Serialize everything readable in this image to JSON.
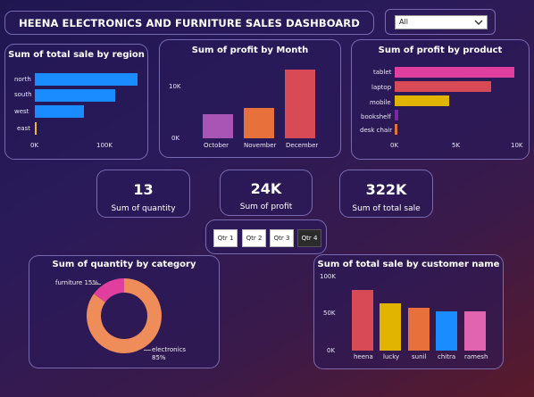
{
  "header": {
    "title": "HEENA ELECTRONICS AND FURNITURE SALES DASHBOARD"
  },
  "filter": {
    "selected": "All"
  },
  "region_chart": {
    "title": "Sum of total sale by region",
    "categories": [
      "north",
      "south",
      "west",
      "east"
    ],
    "ticks": [
      "0K",
      "100K"
    ],
    "color": "#1a8cff",
    "accent": "#f2b632"
  },
  "month_chart": {
    "title": "Sum of profit by Month",
    "categories": [
      "October",
      "November",
      "December"
    ],
    "ticks": [
      "10K",
      "0K"
    ],
    "colors": [
      "#a855b5",
      "#e8703a",
      "#d84a55"
    ]
  },
  "product_chart": {
    "title": "Sum of profit by product",
    "categories": [
      "tablet",
      "laptop",
      "mobile",
      "bookshelf",
      "desk chair"
    ],
    "ticks": [
      "0K",
      "5K",
      "10K"
    ],
    "colors": [
      "#e03fa0",
      "#d84a55",
      "#e0b400",
      "#7a2aa0",
      "#e8703a"
    ]
  },
  "kpis": {
    "quantity": {
      "value": "13",
      "label": "Sum of quantity"
    },
    "profit": {
      "value": "24K",
      "label": "Sum of profit"
    },
    "total_sale": {
      "value": "322K",
      "label": "Sum of total sale"
    }
  },
  "quarters": {
    "q1": "Qtr 1",
    "q2": "Qtr 2",
    "q3": "Qtr 3",
    "q4": "Qtr 4",
    "active": "Qtr 4"
  },
  "category_chart": {
    "title": "Sum of quantity by category",
    "furniture_label": "furniture 15%",
    "electronics_label": "electronics",
    "electronics_pct": "85%",
    "colors": {
      "furniture": "#e03fa0",
      "electronics": "#ee8c5a"
    }
  },
  "customer_chart": {
    "title": "Sum of total sale by customer name",
    "categories": [
      "heena",
      "lucky",
      "sunil",
      "chitra",
      "ramesh"
    ],
    "ticks": [
      "100K",
      "50K",
      "0K"
    ],
    "colors": [
      "#d84a55",
      "#e0b400",
      "#e8703a",
      "#1a8cff",
      "#e064b0"
    ]
  },
  "chart_data": [
    {
      "type": "bar",
      "orientation": "horizontal",
      "title": "Sum of total sale by region",
      "categories": [
        "north",
        "south",
        "west",
        "east"
      ],
      "values": [
        137000,
        107000,
        66000,
        2000
      ],
      "xlim": [
        0,
        150000
      ]
    },
    {
      "type": "bar",
      "title": "Sum of profit by Month",
      "categories": [
        "October",
        "November",
        "December"
      ],
      "values": [
        4700,
        5800,
        13200
      ],
      "ylim": [
        0,
        14000
      ]
    },
    {
      "type": "bar",
      "orientation": "horizontal",
      "title": "Sum of profit by product",
      "categories": [
        "tablet",
        "laptop",
        "mobile",
        "bookshelf",
        "desk chair"
      ],
      "values": [
        10100,
        8100,
        4600,
        300,
        200
      ],
      "xlim": [
        0,
        10500
      ]
    },
    {
      "type": "pie",
      "title": "Sum of quantity by category",
      "categories": [
        "furniture",
        "electronics"
      ],
      "values": [
        15,
        85
      ]
    },
    {
      "type": "bar",
      "title": "Sum of total sale by customer name",
      "categories": [
        "heena",
        "lucky",
        "sunil",
        "chitra",
        "ramesh"
      ],
      "values": [
        82000,
        64000,
        58000,
        53000,
        53000
      ],
      "ylim": [
        0,
        100000
      ]
    }
  ]
}
